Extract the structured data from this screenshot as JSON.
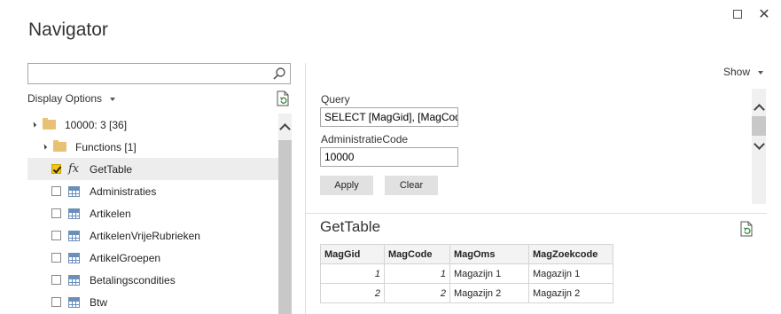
{
  "window": {
    "title": "Navigator",
    "close_glyph": "✕"
  },
  "left": {
    "search": {
      "value": "",
      "placeholder": ""
    },
    "display_options_label": "Display Options",
    "tree": [
      {
        "type": "folder",
        "label": "10000: 3 [36]",
        "level": 0
      },
      {
        "type": "folder",
        "label": "Functions [1]",
        "level": 1
      },
      {
        "type": "function",
        "label": "GetTable",
        "checked": true,
        "selected": true,
        "icon_text": "fx"
      },
      {
        "type": "table",
        "label": "Administraties",
        "checked": false
      },
      {
        "type": "table",
        "label": "Artikelen",
        "checked": false
      },
      {
        "type": "table",
        "label": "ArtikelenVrijeRubrieken",
        "checked": false
      },
      {
        "type": "table",
        "label": "ArtikelGroepen",
        "checked": false
      },
      {
        "type": "table",
        "label": "Betalingscondities",
        "checked": false
      },
      {
        "type": "table",
        "label": "Btw",
        "checked": false
      }
    ]
  },
  "right": {
    "show_label": "Show",
    "query_label": "Query",
    "query_value": "SELECT [MagGid], [MagCode",
    "admin_label": "AdministratieCode",
    "admin_value": "10000",
    "apply_label": "Apply",
    "clear_label": "Clear",
    "preview_title": "GetTable",
    "table": {
      "columns": [
        "MagGid",
        "MagCode",
        "MagOms",
        "MagZoekcode"
      ],
      "rows": [
        [
          "1",
          "1",
          "Magazijn 1",
          "Magazijn 1"
        ],
        [
          "2",
          "2",
          "Magazijn 2",
          "Magazijn 2"
        ]
      ]
    }
  },
  "colors": {
    "checkbox_checked": "#f2c811",
    "folder": "#e8c174",
    "selected_row": "#ededed",
    "table_icon": "#6b8fb8"
  }
}
